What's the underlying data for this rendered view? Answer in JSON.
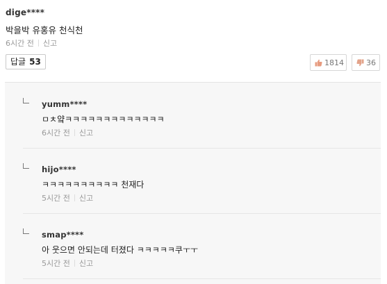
{
  "comment": {
    "author": "dige****",
    "text": "박을박 유홍유 천식천",
    "time": "6시간 전",
    "report": "신고",
    "reply_label": "답글",
    "reply_count": "53",
    "likes": "1814",
    "dislikes": "36"
  },
  "replies": [
    {
      "author": "yumm****",
      "text": "ㅁㅊ얔ㅋㅋㅋㅋㅋㅋㅋㅋㅋㅋㅋㅋㅋ",
      "time": "6시간 전",
      "report": "신고"
    },
    {
      "author": "hijo****",
      "text": "ㅋㅋㅋㅋㅋㅋㅋㅋㅋㅋ 천재다",
      "time": "5시간 전",
      "report": "신고"
    },
    {
      "author": "smap****",
      "text": "아 웃으면 안되는데 터졌다 ㅋㅋㅋㅋㅋ쿠ㅜㅜ",
      "time": "5시간 전",
      "report": "신고"
    }
  ],
  "colors": {
    "meta_text": "#999999",
    "reply_bg": "#f7f7f7",
    "border": "#c9c9c9"
  },
  "icons": {
    "like": "thumbs-up-icon",
    "dislike": "thumbs-down-icon",
    "reply_arrow": "reply-arrow-icon"
  }
}
